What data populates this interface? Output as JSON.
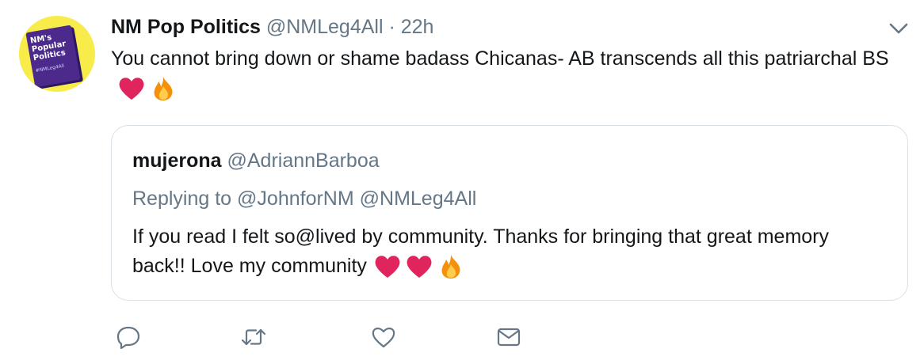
{
  "tweet": {
    "avatar": {
      "line1": "NM's",
      "line2": "Popular",
      "line3": "Politics",
      "tag": "#NMLeg4All",
      "background": "#f7ec4a",
      "book_color": "#4b2a8c"
    },
    "display_name": "NM Pop Politics",
    "handle": "@NMLeg4All",
    "separator": "·",
    "timestamp": "22h",
    "text_before_emoji": "You cannot bring down or shame badass Chicanas- AB transcends all this patriarchal BS",
    "emojis": [
      "red-heart",
      "fire"
    ],
    "menu_icon": "chevron-down-icon"
  },
  "quoted_tweet": {
    "display_name": "mujerona",
    "handle": "@AdriannBarboa",
    "replying_label": "Replying to",
    "replying_to": [
      "@JohnforNM",
      "@NMLeg4All"
    ],
    "text": "If you read I felt so@lived by community. Thanks for bringing that great memory back!!  Love my community",
    "emojis": [
      "red-heart",
      "red-heart",
      "fire"
    ]
  },
  "actions": [
    {
      "name": "reply",
      "icon": "reply-icon"
    },
    {
      "name": "retweet",
      "icon": "retweet-icon"
    },
    {
      "name": "like",
      "icon": "heart-icon"
    },
    {
      "name": "direct-message",
      "icon": "envelope-icon"
    }
  ],
  "colors": {
    "text": "#14171a",
    "secondary": "#657786",
    "border": "#d9e0e6",
    "heart": "#e0245e",
    "flame": "#f4900c"
  }
}
